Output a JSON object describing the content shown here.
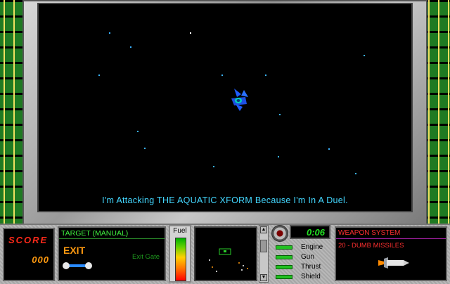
{
  "viewport": {
    "message": "I'm Attacking THE AQUATIC XFORM Because I'm In A Duel."
  },
  "hud": {
    "score_label": "SCORE",
    "score_value": "000",
    "target_title": "TARGET (MANUAL)",
    "target_name": "EXIT",
    "target_type": "Exit Gate",
    "fuel_label": "Fuel",
    "fuel_level": 1.0,
    "timer": "0:06",
    "systems": [
      {
        "label": "Engine"
      },
      {
        "label": "Gun"
      },
      {
        "label": "Thrust"
      },
      {
        "label": "Shield"
      }
    ],
    "weapon_title": "WEAPON SYSTEM",
    "weapon_name": "20 - DUMB MISSILES"
  },
  "colors": {
    "message": "#43d7ff",
    "score": "#ff2a1a",
    "score_value": "#ff9a10",
    "panel_green": "#3ef03e",
    "weapon_red": "#ff3030",
    "system_led": "#22c022"
  }
}
